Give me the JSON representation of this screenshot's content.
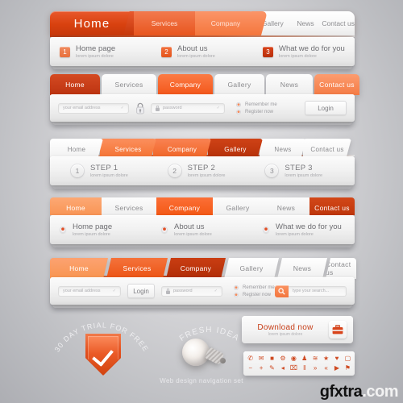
{
  "meta": {
    "caption": "Web design navigation set",
    "watermark_dark": "gfxtra",
    "watermark_light": ".com"
  },
  "bars": [
    {
      "id": "bar1",
      "tabs": [
        {
          "label": "Home",
          "active": true
        },
        {
          "label": "Services",
          "active": true
        },
        {
          "label": "Company",
          "active": true
        },
        {
          "label": "Gallery",
          "active": false
        },
        {
          "label": "News",
          "active": false
        },
        {
          "label": "Contact us",
          "active": false
        }
      ],
      "cells": [
        {
          "num": "1",
          "title": "Home page",
          "sub": "lorem ipsum dolore"
        },
        {
          "num": "2",
          "title": "About us",
          "sub": "lorem ipsum dolore"
        },
        {
          "num": "3",
          "title": "What we do for you",
          "sub": "lorem ipsum dolore"
        }
      ]
    },
    {
      "id": "bar2",
      "tabs": [
        {
          "label": "Home",
          "active": true
        },
        {
          "label": "Services",
          "active": false
        },
        {
          "label": "Company",
          "active": true
        },
        {
          "label": "Gallery",
          "active": false
        },
        {
          "label": "News",
          "active": false
        },
        {
          "label": "Contact us",
          "active": true
        }
      ],
      "form": {
        "email_placeholder": "your email address",
        "password_placeholder": "password",
        "remember_label": "Remember me",
        "register_label": "Register now",
        "login_label": "Login"
      }
    },
    {
      "id": "bar3",
      "tabs": [
        {
          "label": "Home",
          "active": false
        },
        {
          "label": "Services",
          "active": true
        },
        {
          "label": "Company",
          "active": true
        },
        {
          "label": "Gallery",
          "active": true
        },
        {
          "label": "News",
          "active": false
        },
        {
          "label": "Contact us",
          "active": false
        }
      ],
      "steps": [
        {
          "num": "1",
          "title": "STEP 1",
          "sub": "lorem ipsum dolore"
        },
        {
          "num": "2",
          "title": "STEP 2",
          "sub": "lorem ipsum dolore"
        },
        {
          "num": "3",
          "title": "STEP 3",
          "sub": "lorem ipsum dolore"
        }
      ]
    },
    {
      "id": "bar4",
      "tabs": [
        {
          "label": "Home",
          "active": true
        },
        {
          "label": "Services",
          "active": false
        },
        {
          "label": "Company",
          "active": true
        },
        {
          "label": "Gallery",
          "active": false
        },
        {
          "label": "News",
          "active": false
        },
        {
          "label": "Contact us",
          "active": true
        }
      ],
      "cells": [
        {
          "title": "Home page",
          "sub": "lorem ipsum dolore"
        },
        {
          "title": "About us",
          "sub": "lorem ipsum dolore"
        },
        {
          "title": "What we do for you",
          "sub": "lorem ipsum dolore"
        }
      ]
    },
    {
      "id": "bar5",
      "tabs": [
        {
          "label": "Home",
          "active": true
        },
        {
          "label": "Services",
          "active": true
        },
        {
          "label": "Company",
          "active": true
        },
        {
          "label": "Gallery",
          "active": false
        },
        {
          "label": "News",
          "active": false
        },
        {
          "label": "Contact us",
          "active": false
        }
      ],
      "form": {
        "email_placeholder": "your email address",
        "login_label": "Login",
        "password_placeholder": "password",
        "remember_label": "Remember me",
        "register_label": "Register now",
        "search_placeholder": "type your search..."
      }
    }
  ],
  "showcase": {
    "trial_badge_text": "30 DAY TRIAL FOR FREE",
    "fresh_idea_text": "FRESH IDEA",
    "download": {
      "title": "Download now",
      "sub": "lorem ipsum dolore"
    },
    "icon_palette": {
      "row1": [
        "✆",
        "✉",
        "ὋC",
        "⚙",
        "◉",
        "♟",
        "≋",
        "★",
        "♥",
        "⬜"
      ],
      "row2": [
        "−",
        "+",
        "✎",
        "◂",
        "⌧",
        "‖",
        "»",
        "«",
        "▶",
        "⚑"
      ],
      "row1_names": [
        "phone-icon",
        "envelope-icon",
        "briefcase-icon",
        "gear-icon",
        "target-icon",
        "user-icon",
        "rss-icon",
        "star-icon",
        "heart-icon",
        "speech-bubble-icon"
      ],
      "row2_names": [
        "minus-icon",
        "plus-icon",
        "pencil-icon",
        "volume-icon",
        "trash-icon",
        "pause-icon",
        "forward-icon",
        "rewind-icon",
        "play-icon",
        "pin-icon"
      ]
    }
  },
  "colors": {
    "accent_dark": "#c63a0f",
    "accent": "#ef6222",
    "accent_light": "#fb9468",
    "panel": "#f2f2f2",
    "text_muted": "#8b8b8e"
  }
}
